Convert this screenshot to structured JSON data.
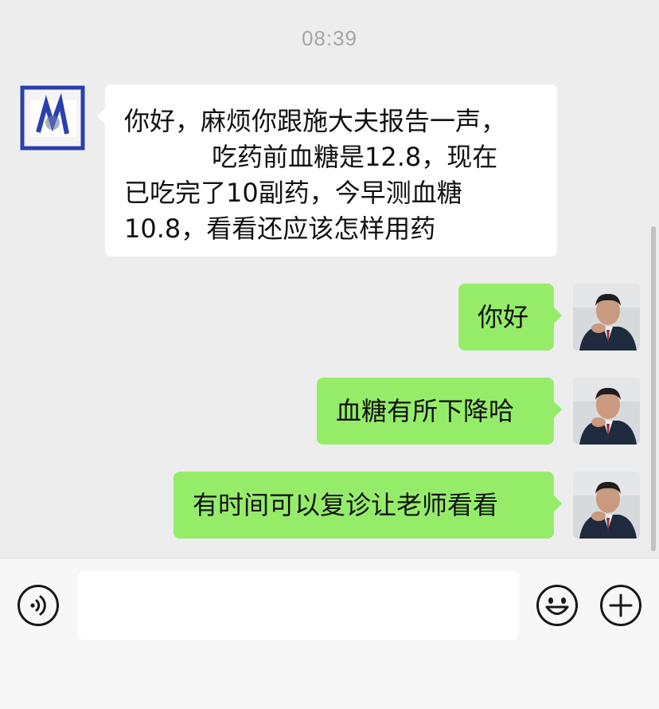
{
  "header": {
    "time": "08:39"
  },
  "messages": [
    {
      "side": "left",
      "lines": [
        "你好，麻烦你跟施大夫报告一声，",
        "吃药前血糖是12.8，现在",
        "已吃完了10副药，今早测血糖",
        "10.8，看看还应该怎样用药"
      ]
    },
    {
      "side": "right",
      "text": "你好"
    },
    {
      "side": "right",
      "text": "血糖有所下降哈"
    },
    {
      "side": "right",
      "text": "有时间可以复诊让老师看看"
    }
  ],
  "input_bar": {
    "voice_icon": "voice-icon",
    "emoji_icon": "emoji-icon",
    "plus_icon": "plus-icon",
    "input_value": ""
  },
  "colors": {
    "background": "#ededed",
    "sent_bubble": "#95ec69",
    "received_bubble": "#ffffff",
    "timestamp": "#a6a6a6"
  }
}
